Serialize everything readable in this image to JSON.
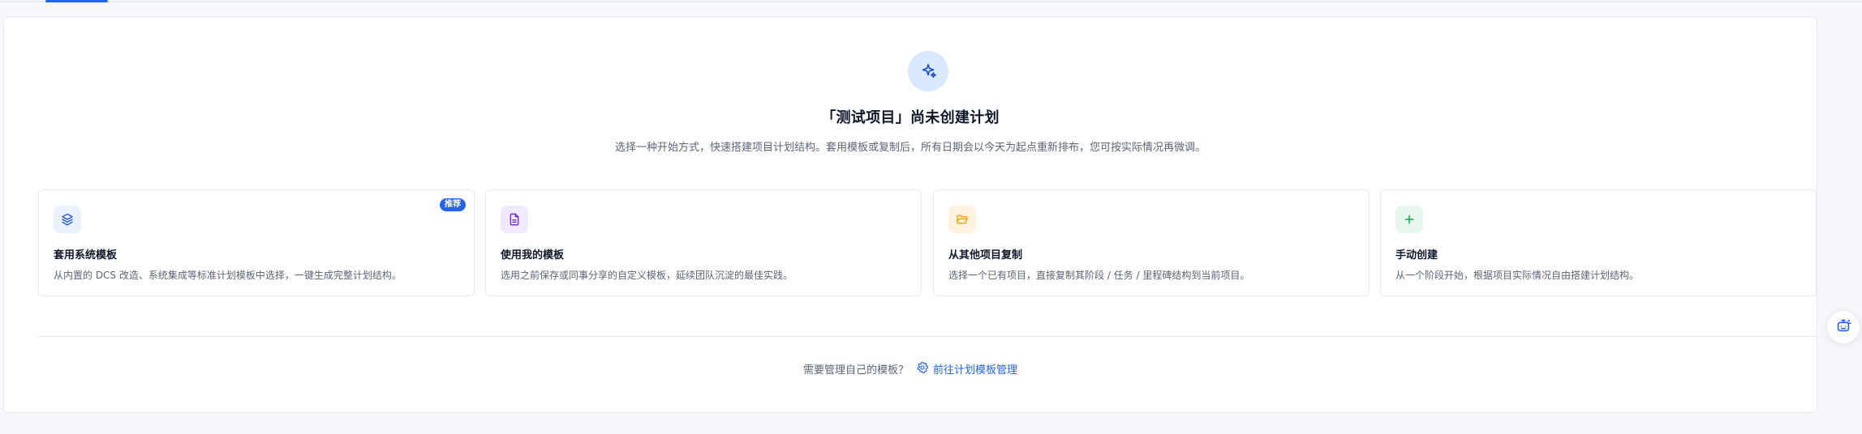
{
  "page": {
    "title": "「测试项目」尚未创建计划",
    "subtitle": "选择一种开始方式，快速搭建项目计划结构。套用模板或复制后，所有日期会以今天为起点重新排布，您可按实际情况再微调。"
  },
  "cards": [
    {
      "title": "套用系统模板",
      "desc": "从内置的 DCS 改造、系统集成等标准计划模板中选择，一键生成完整计划结构。",
      "badge": "推荐",
      "icon": "layers-icon",
      "tile_color": "#eaf2ff"
    },
    {
      "title": "使用我的模板",
      "desc": "选用之前保存或同事分享的自定义模板，延续团队沉淀的最佳实践。",
      "icon": "document-icon",
      "tile_color": "#f0e9ff"
    },
    {
      "title": "从其他项目复制",
      "desc": "选择一个已有项目，直接复制其阶段 / 任务 / 里程碑结构到当前项目。",
      "icon": "folder-open-icon",
      "tile_color": "#fff2df"
    },
    {
      "title": "手动创建",
      "desc": "从一个阶段开始，根据项目实际情况自由搭建计划结构。",
      "icon": "plus-icon",
      "tile_color": "#e7f7ee"
    }
  ],
  "footer": {
    "prompt": "需要管理自己的模板？",
    "link_label": "前往计划模板管理"
  },
  "colors": {
    "accent": "#2563eb",
    "text": "#0f172a",
    "muted": "#5b6475",
    "border": "#e6e9ef",
    "background": "#f6f8fb"
  }
}
